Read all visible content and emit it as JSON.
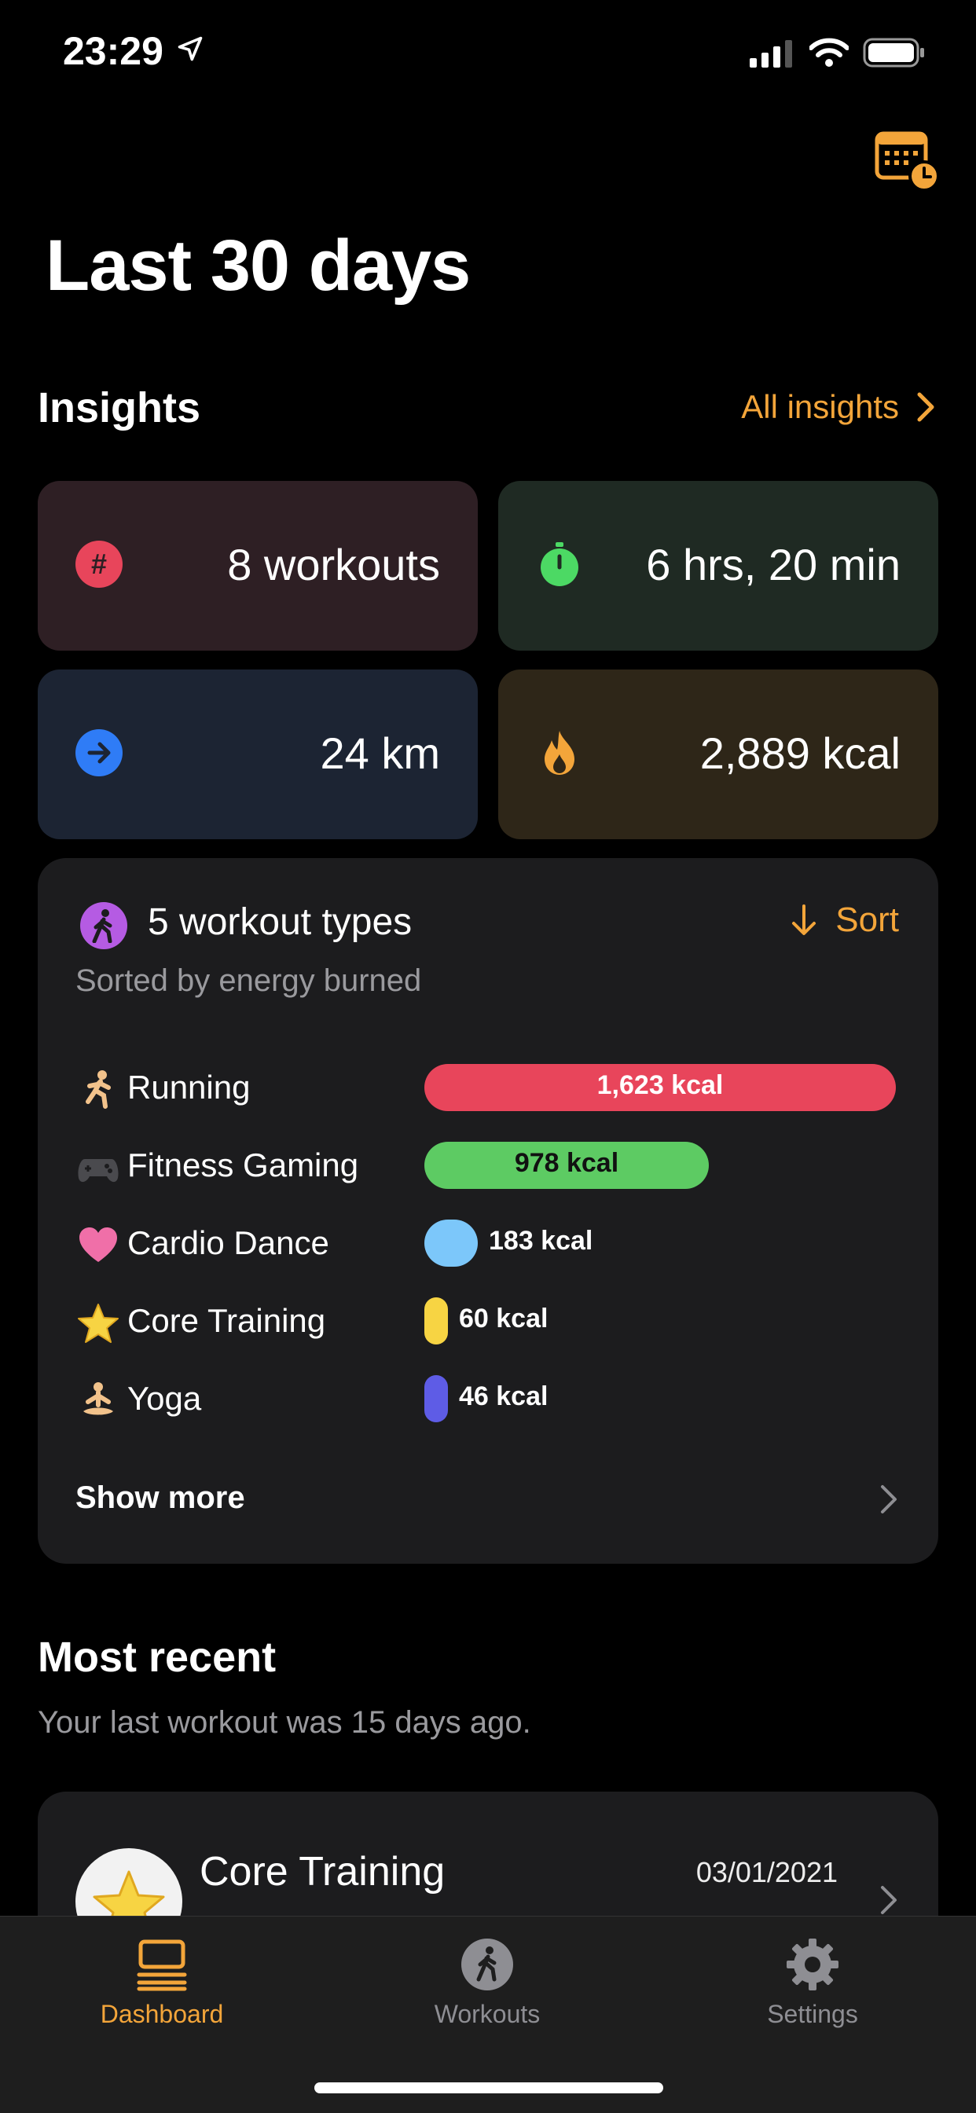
{
  "status_bar": {
    "time": "23:29"
  },
  "header": {
    "title": "Last 30 days",
    "calendar_icon": "calendar-clock-icon"
  },
  "insights": {
    "title": "Insights",
    "all_insights_label": "All insights",
    "tiles": [
      {
        "icon": "hashtag-icon",
        "value": "8 workouts",
        "color": "#E8455B"
      },
      {
        "icon": "stopwatch-icon",
        "value": "6 hrs, 20 min",
        "color": "#4CD964"
      },
      {
        "icon": "arrow-right-icon",
        "value": "24 km",
        "color": "#2F7CF6"
      },
      {
        "icon": "flame-icon",
        "value": "2,889 kcal",
        "color": "#F3A53A"
      }
    ]
  },
  "workout_types": {
    "title": "5 workout types",
    "subtitle": "Sorted by energy burned",
    "sort_label": "Sort",
    "max_kcal": 1623,
    "items": [
      {
        "emoji": "runner",
        "name": "Running",
        "kcal": 1623,
        "label": "1,623 kcal",
        "color": "#E8455B"
      },
      {
        "emoji": "game-controller",
        "name": "Fitness Gaming",
        "kcal": 978,
        "label": "978 kcal",
        "color": "#5DCB63"
      },
      {
        "emoji": "heart",
        "name": "Cardio Dance",
        "kcal": 183,
        "label": "183 kcal",
        "color": "#7CC7FA"
      },
      {
        "emoji": "star",
        "name": "Core Training",
        "kcal": 60,
        "label": "60 kcal",
        "color": "#F7D443"
      },
      {
        "emoji": "yoga",
        "name": "Yoga",
        "kcal": 46,
        "label": "46 kcal",
        "color": "#5E5CE6"
      }
    ],
    "show_more_label": "Show more"
  },
  "most_recent": {
    "title": "Most recent",
    "subtitle": "Your last workout was 15 days ago.",
    "card": {
      "name": "Core Training",
      "date": "03/01/2021"
    }
  },
  "tabbar": {
    "dashboard": "Dashboard",
    "workouts": "Workouts",
    "settings": "Settings"
  },
  "colors": {
    "accent": "#F3A53A",
    "background": "#000000",
    "card": "#1C1C1E"
  }
}
